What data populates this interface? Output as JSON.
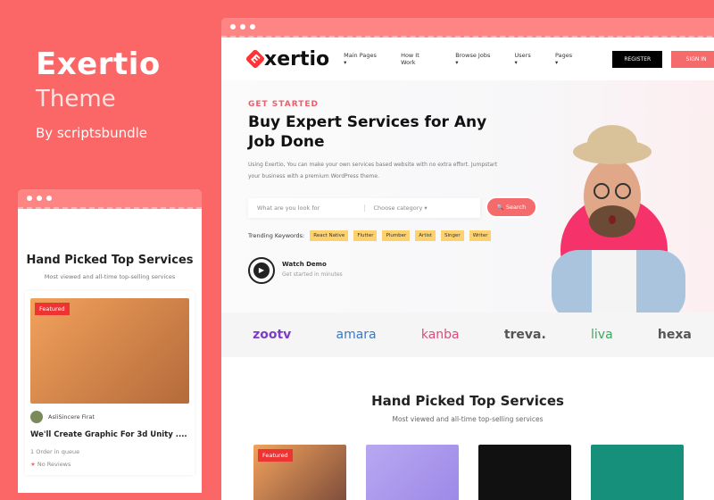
{
  "brand": {
    "title": "Exertio",
    "subtitle": "Theme",
    "author": "By scriptsbundle"
  },
  "nav": {
    "logo": "xertio",
    "logo_mark": "E",
    "items": [
      "Main Pages ▾",
      "How It Work",
      "Browse Jobs ▾",
      "Users ▾",
      "Pages ▾"
    ],
    "register": "REGISTER",
    "signin": "SIGN IN"
  },
  "hero": {
    "kicker": "GET STARTED",
    "title": "Buy Expert Services for Any Job Done",
    "desc": "Using Exertio, You can make your own services based website with no extra effort. Jumpstart your business with a premium WordPress theme.",
    "search_placeholder": "What are you look for",
    "category": "Choose category ▾",
    "search_btn": "🔍 Search",
    "trending_label": "Trending Keywords:",
    "keywords": [
      "React Native",
      "Flutter",
      "Plumber",
      "Artist",
      "Singer",
      "Writer"
    ],
    "watch": "Watch Demo",
    "watch_sub": "Get started in minutes"
  },
  "partners": [
    "zootv",
    "amara",
    "kanba",
    "treva.",
    "liva",
    "hexa"
  ],
  "colors": {
    "accent": "#f56a6a",
    "background": "#fb6767",
    "keyword": "#fdd26e"
  },
  "services": {
    "title": "Hand Picked Top Services",
    "subtitle": "Most viewed and all-time top-selling services",
    "featured": "Featured"
  },
  "mobile": {
    "title": "Hand Picked Top Services",
    "subtitle": "Most viewed and all-time top-selling services",
    "featured": "Featured",
    "user": "AsliSincere Firat",
    "card_title": "We'll Create Graphic For 3d Unity ....",
    "queue": "1 Order in queue",
    "reviews": "No Reviews"
  }
}
